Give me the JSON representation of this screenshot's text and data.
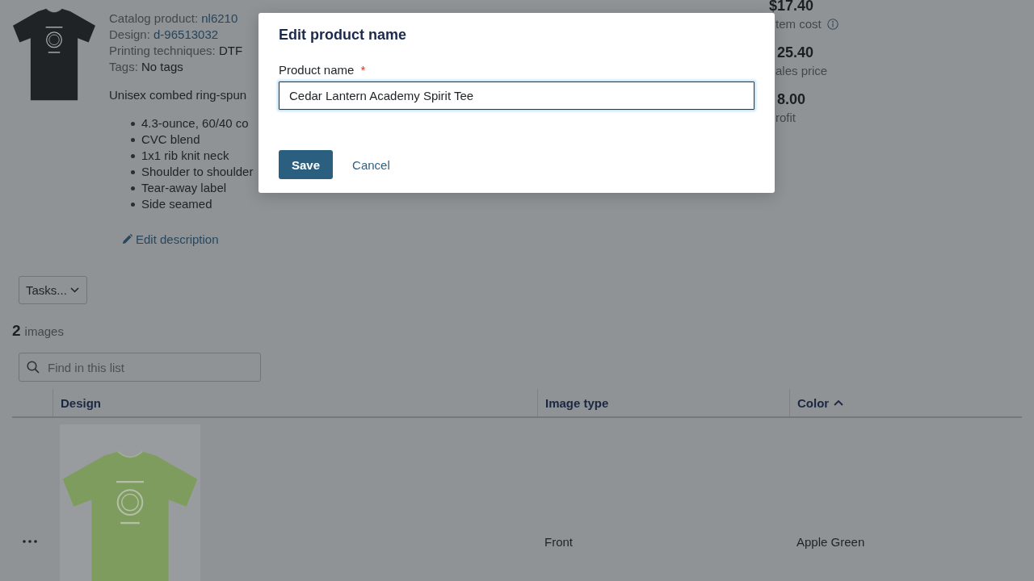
{
  "product": {
    "details": [
      {
        "label": "Catalog product:",
        "value": "nl6210",
        "kind": "link"
      },
      {
        "label": "Design:",
        "value": "d-96513032",
        "kind": "link"
      },
      {
        "label": "Printing techniques:",
        "value": "DTF",
        "kind": "text"
      },
      {
        "label": "Tags:",
        "value": "No tags",
        "kind": "text"
      }
    ],
    "description": "Unisex combed ring-spun",
    "features": [
      "4.3-ounce, 60/40 co",
      "CVC blend",
      "1x1 rib knit neck",
      "Shoulder to shoulder",
      "Tear-away label",
      "Side seamed"
    ],
    "edit_description": "Edit description"
  },
  "summary": [
    {
      "value": "$17.40",
      "label": "tem cost",
      "info": true
    },
    {
      "value": "25.40",
      "label": "ales price",
      "info": false
    },
    {
      "value": "8.00",
      "label": "rofit",
      "info": false
    }
  ],
  "tasks_menu": {
    "label": "Tasks..."
  },
  "images_count": {
    "count": "2",
    "label": "images"
  },
  "search": {
    "placeholder": "Find in this list"
  },
  "table": {
    "columns": [
      {
        "label": "Design",
        "sorted": false
      },
      {
        "label": "Image type",
        "sorted": false
      },
      {
        "label": "Color",
        "sorted": true
      }
    ],
    "rows": [
      {
        "image_type": "Front",
        "color_name": "Apple Green"
      }
    ]
  },
  "dialog": {
    "title": "Edit product name",
    "field": {
      "label": "Product name",
      "required_mark": "*",
      "value": "Cedar Lantern Academy Spirit Tee",
      "focused": true
    },
    "buttons": [
      {
        "label": "Save",
        "kind": "primary"
      },
      {
        "label": "Cancel",
        "kind": "link"
      }
    ]
  }
}
